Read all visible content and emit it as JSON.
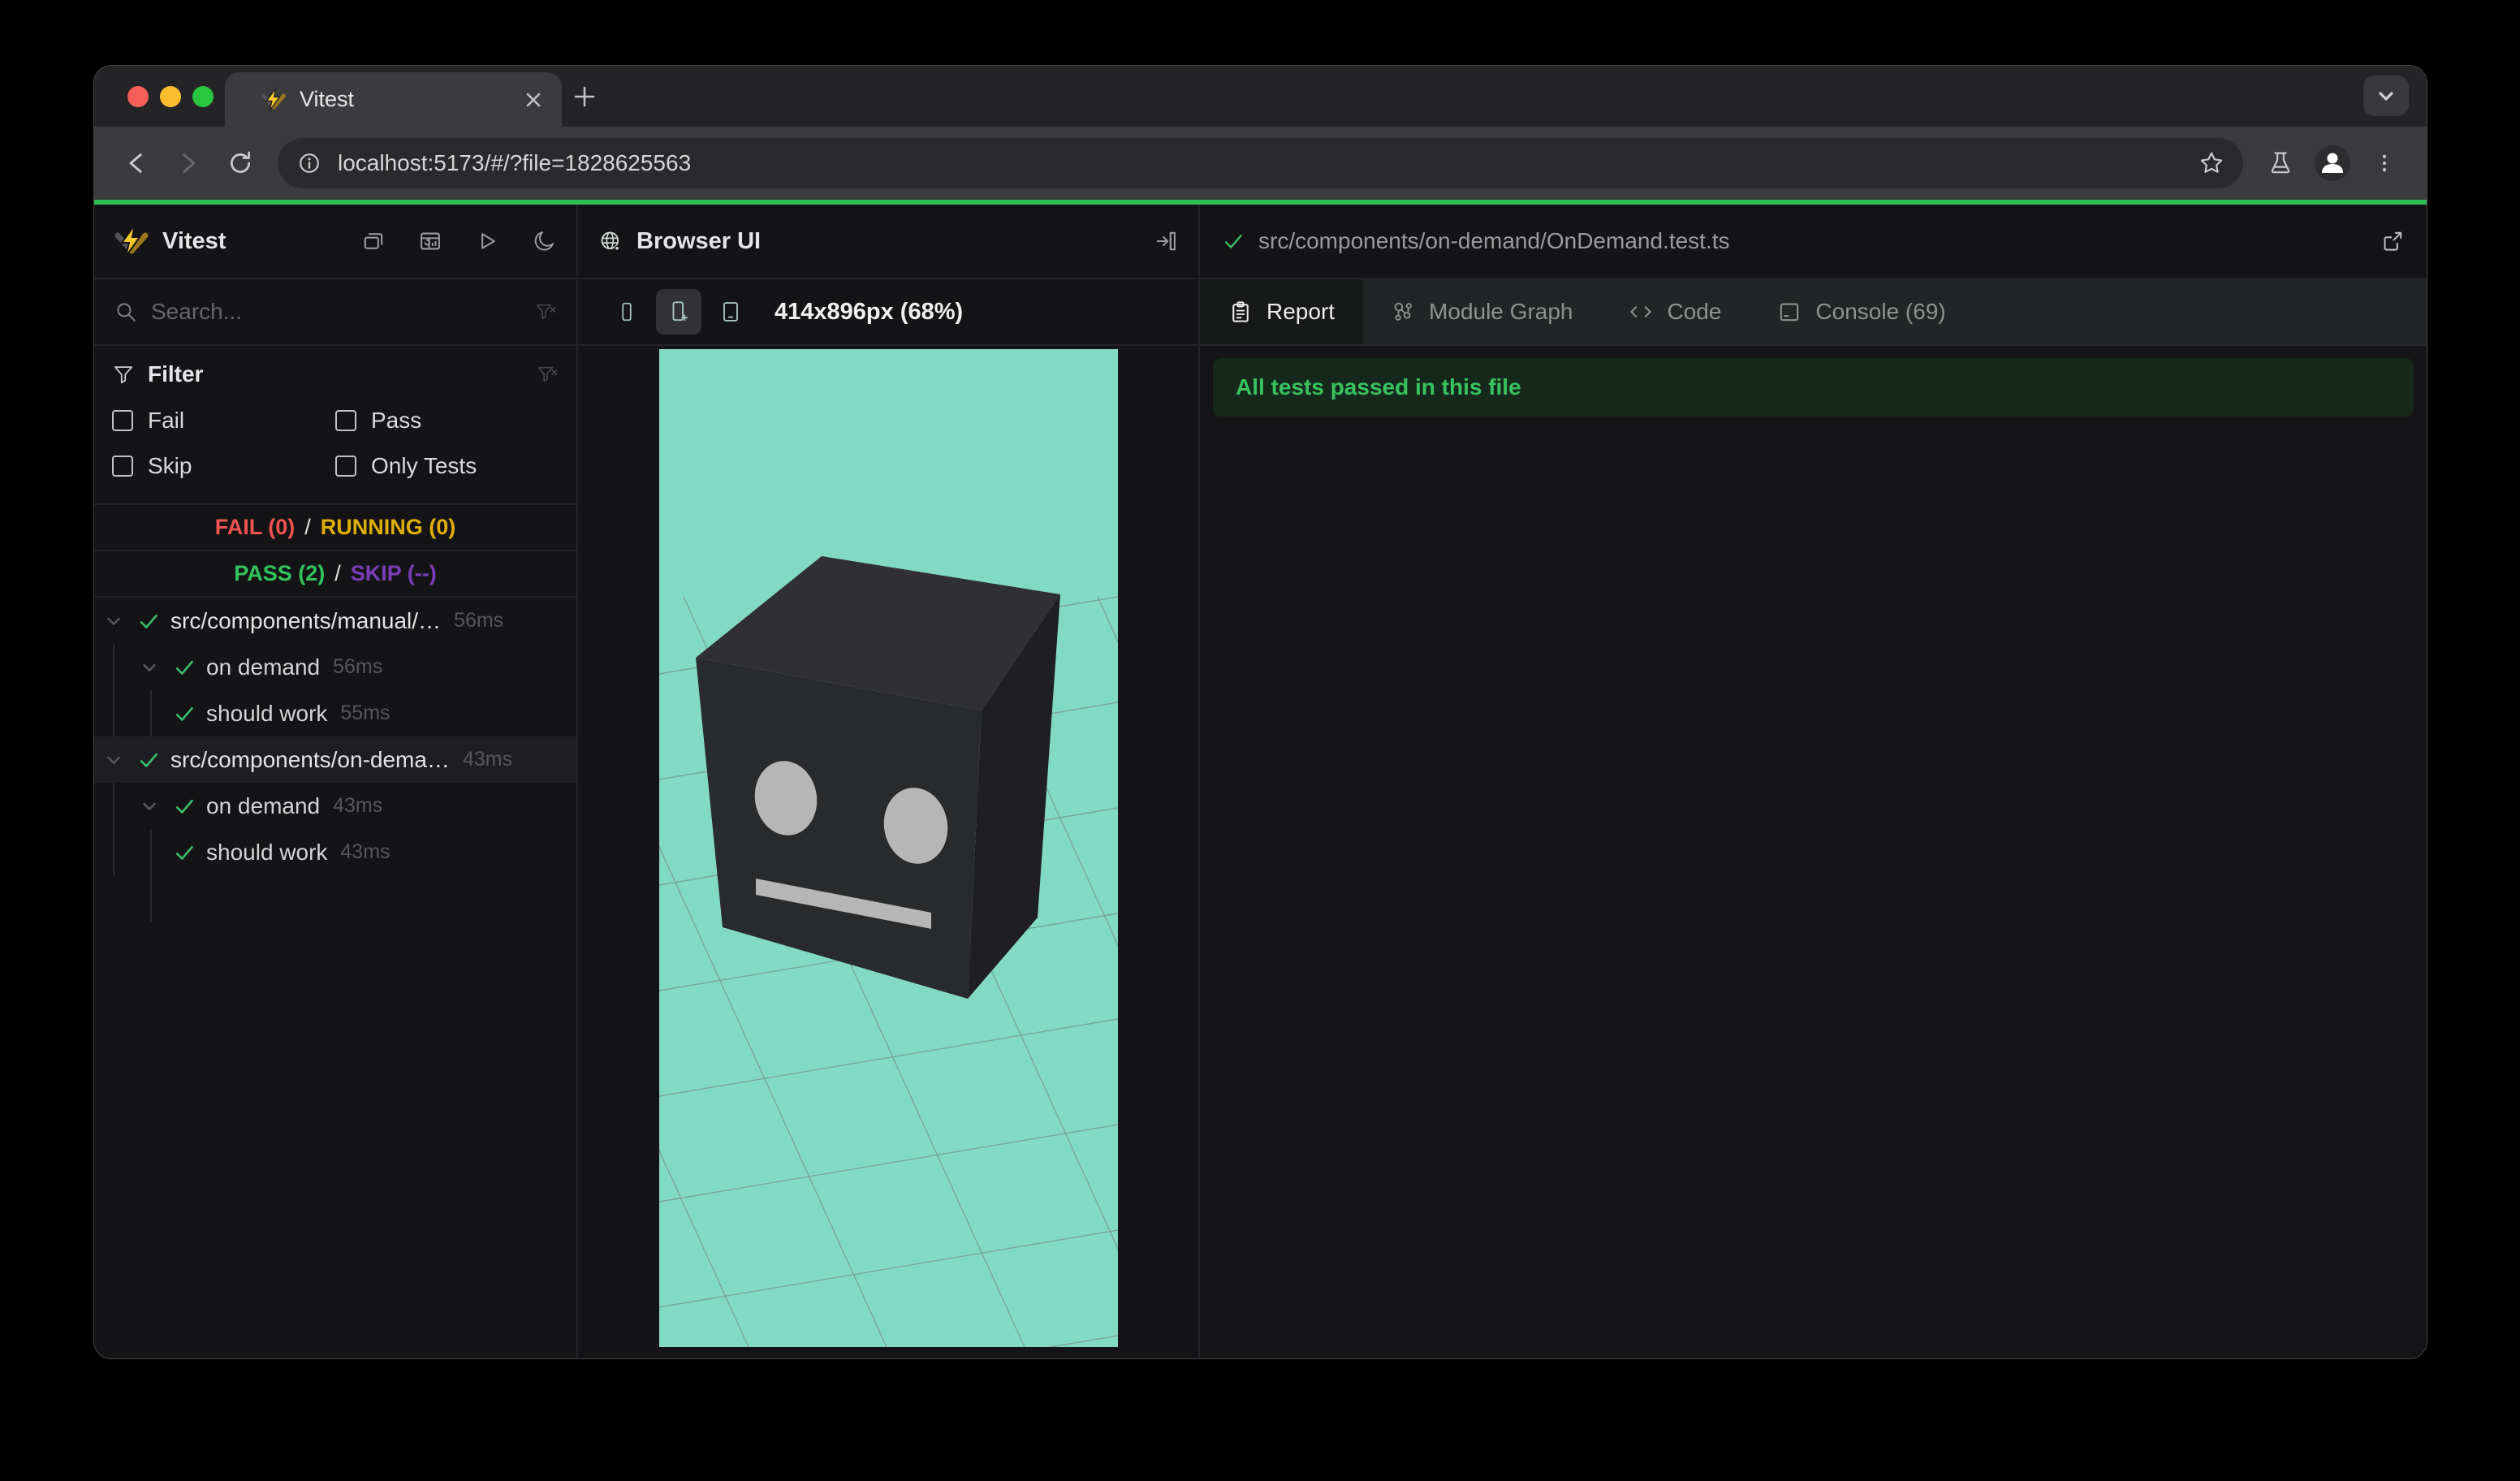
{
  "browser": {
    "tab_title": "Vitest",
    "url": "localhost:5173/#/?file=1828625563"
  },
  "sidebar": {
    "app_title": "Vitest",
    "search_placeholder": "Search...",
    "filter": {
      "title": "Filter",
      "options": [
        "Fail",
        "Pass",
        "Skip",
        "Only Tests"
      ]
    },
    "summary": {
      "fail": "FAIL (0)",
      "running": "RUNNING (0)",
      "pass": "PASS (2)",
      "skip": "SKIP (--)",
      "sep": "/"
    },
    "tree": [
      {
        "label": "src/components/manual/…",
        "duration": "56ms"
      },
      {
        "label": "on demand",
        "duration": "56ms"
      },
      {
        "label": "should work",
        "duration": "55ms"
      },
      {
        "label": "src/components/on-dema…",
        "duration": "43ms"
      },
      {
        "label": "on demand",
        "duration": "43ms"
      },
      {
        "label": "should work",
        "duration": "43ms"
      }
    ]
  },
  "preview": {
    "panel_title": "Browser UI",
    "viewport_label": "414x896px (68%)"
  },
  "detail": {
    "file_path": "src/components/on-demand/OnDemand.test.ts",
    "tabs": [
      {
        "label": "Report"
      },
      {
        "label": "Module Graph"
      },
      {
        "label": "Code"
      },
      {
        "label": "Console (69)"
      }
    ],
    "banner": "All tests passed in this file"
  },
  "colors": {
    "fail_red": "#ef5350",
    "running_amber": "#dfae07",
    "pass_green": "#31c45c",
    "skip_purple": "#7a3db8",
    "progress_green": "#2fbe53",
    "check_green": "#3cc06a",
    "scene_background": "#83dac3",
    "banner_background": "#16281c",
    "banner_text": "#37c35f",
    "logo_amber": "#fcc72b"
  }
}
